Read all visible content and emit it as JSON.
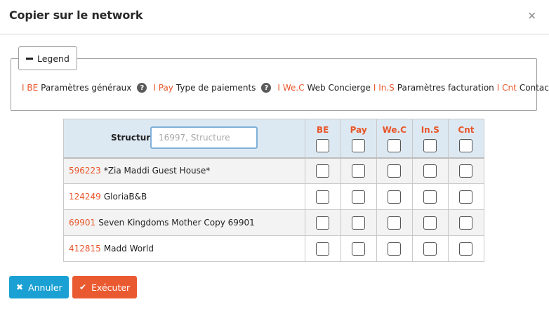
{
  "modal": {
    "title": "Copier sur le network",
    "close_glyph": "×"
  },
  "legend": {
    "button_label": "Legend",
    "items": [
      {
        "code": "I BE",
        "label": "Paramètres généraux",
        "help": true
      },
      {
        "code": "I Pay",
        "label": "Type de paiements",
        "help": true
      },
      {
        "code": "I We.C",
        "label": "Web Concierge",
        "help": false
      },
      {
        "code": "I In.S",
        "label": "Paramètres facturation",
        "help": false
      },
      {
        "code": "I Cnt",
        "label": "Contacts",
        "help": false
      }
    ]
  },
  "table": {
    "structure_label": "Structure",
    "search_placeholder": "16997, Structure",
    "columns": [
      "BE",
      "Pay",
      "We.C",
      "In.S",
      "Cnt"
    ],
    "rows": [
      {
        "id": "596223",
        "name": "*Zia Maddi Guest House*"
      },
      {
        "id": "124249",
        "name": "GloriaB&B"
      },
      {
        "id": "69901",
        "name": "Seven Kingdoms Mother Copy 69901"
      },
      {
        "id": "412815",
        "name": "Madd World"
      }
    ]
  },
  "footer": {
    "cancel_label": "Annuler",
    "execute_label": "Exécuter"
  },
  "colors": {
    "accent": "#e8562a",
    "cancel": "#1aa0d3",
    "execute": "#ea5a30",
    "header_bg": "#dde9f2"
  }
}
